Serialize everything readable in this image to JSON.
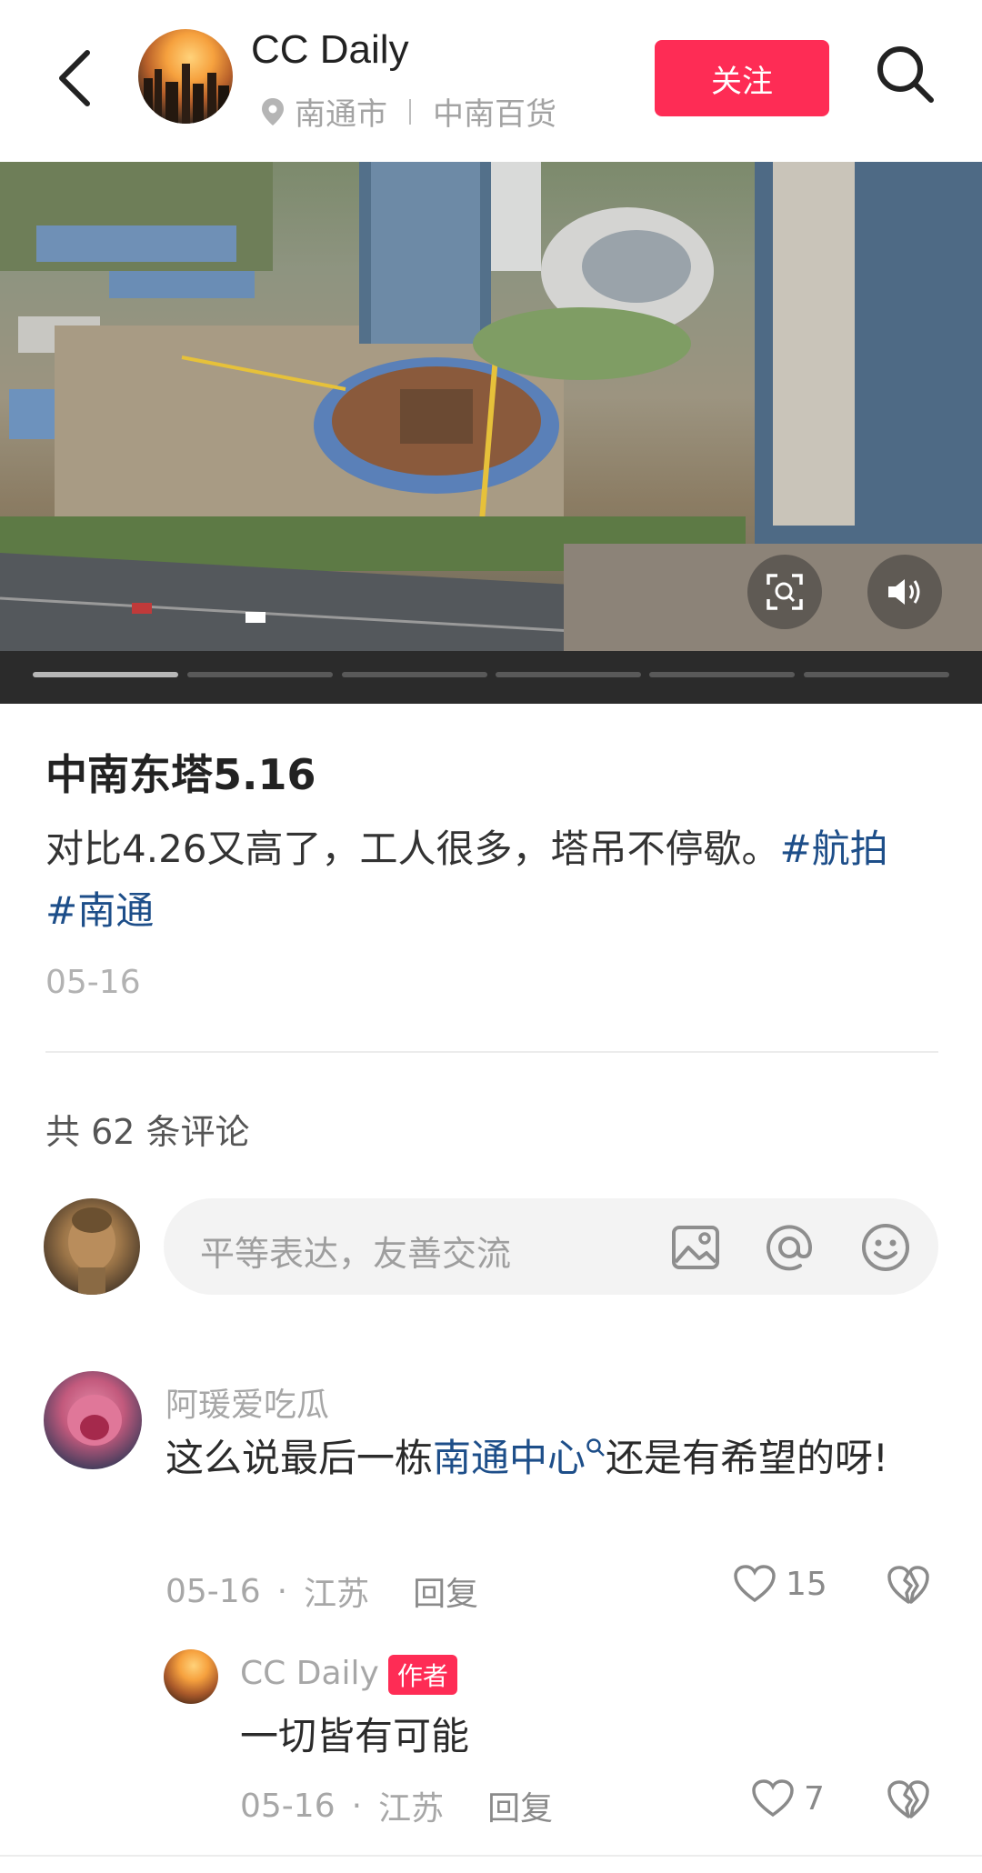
{
  "header": {
    "author_name": "CC Daily",
    "location_city": "南通市",
    "location_place": "中南百货",
    "follow_label": "关注"
  },
  "media": {
    "progress": {
      "segments": 6,
      "active_index": 0
    }
  },
  "post": {
    "title": "中南东塔5.16",
    "body_text": "对比4.26又高了，工人很多，塔吊不停歇。",
    "hashtags": [
      "#航拍",
      "#南通"
    ],
    "date": "05-16"
  },
  "comments_section": {
    "count_label": "共 62 条评论",
    "input_placeholder": "平等表达，友善交流"
  },
  "comments": [
    {
      "user": "阿瑗爱吃瓜",
      "text_before": "这么说最后一栋",
      "link": "南通中心",
      "text_after": "还是有希望的呀!",
      "date": "05-16",
      "region": "江苏",
      "reply_label": "回复",
      "likes": "15"
    }
  ],
  "reply": {
    "user": "CC Daily",
    "badge": "作者",
    "text": "一切皆有可能",
    "date": "05-16",
    "region": "江苏",
    "reply_label": "回复",
    "likes": "7"
  },
  "icons": {
    "back": "chevron-left-icon",
    "location": "location-pin-icon",
    "search": "search-icon",
    "scan": "scan-icon",
    "volume": "volume-icon",
    "image": "image-icon",
    "mention": "at-icon",
    "emoji": "emoji-icon",
    "like": "heart-icon",
    "dislike": "broken-heart-icon"
  },
  "colors": {
    "accent": "#fe2c55",
    "link": "#1d4e89"
  }
}
